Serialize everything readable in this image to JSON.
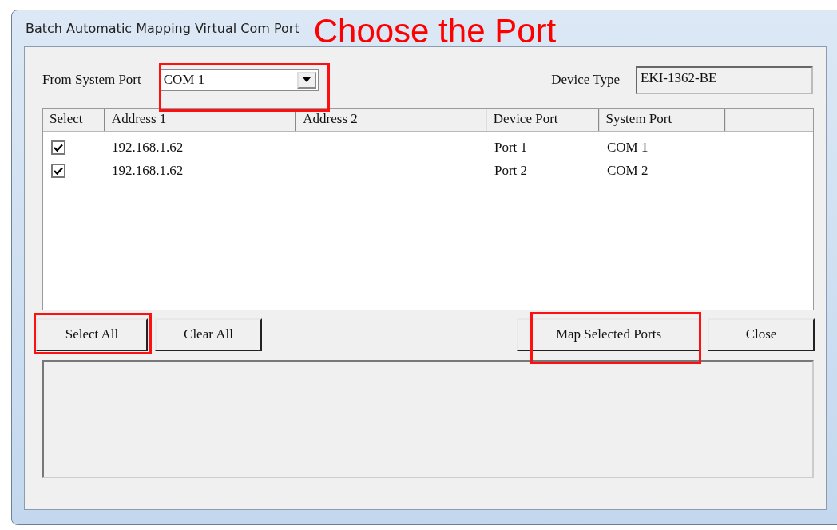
{
  "window": {
    "title": "Batch Automatic Mapping Virtual Com Port"
  },
  "annotation": {
    "text": "Choose the Port"
  },
  "from_system_port": {
    "label": "From System Port",
    "value": "COM 1",
    "highlighted": true
  },
  "device_type": {
    "label": "Device Type",
    "value": "EKI-1362-BE"
  },
  "table": {
    "columns": [
      "Select",
      "Address 1",
      "Address 2",
      "Device Port",
      "System Port"
    ],
    "rows": [
      {
        "checked": true,
        "address_1": "192.168.1.62",
        "device_port": "Port 1",
        "system_port": "COM 1"
      },
      {
        "checked": true,
        "address_1": "192.168.1.62",
        "device_port": "Port 2",
        "system_port": "COM 2"
      }
    ]
  },
  "buttons": [
    {
      "label": "Select All",
      "highlighted": true
    },
    {
      "label": "Clear All",
      "highlighted": false
    }
  ],
  "buttons_right": [
    {
      "label": "Map Selected Ports",
      "highlighted": true
    },
    {
      "label": "Close",
      "highlighted": false
    }
  ]
}
